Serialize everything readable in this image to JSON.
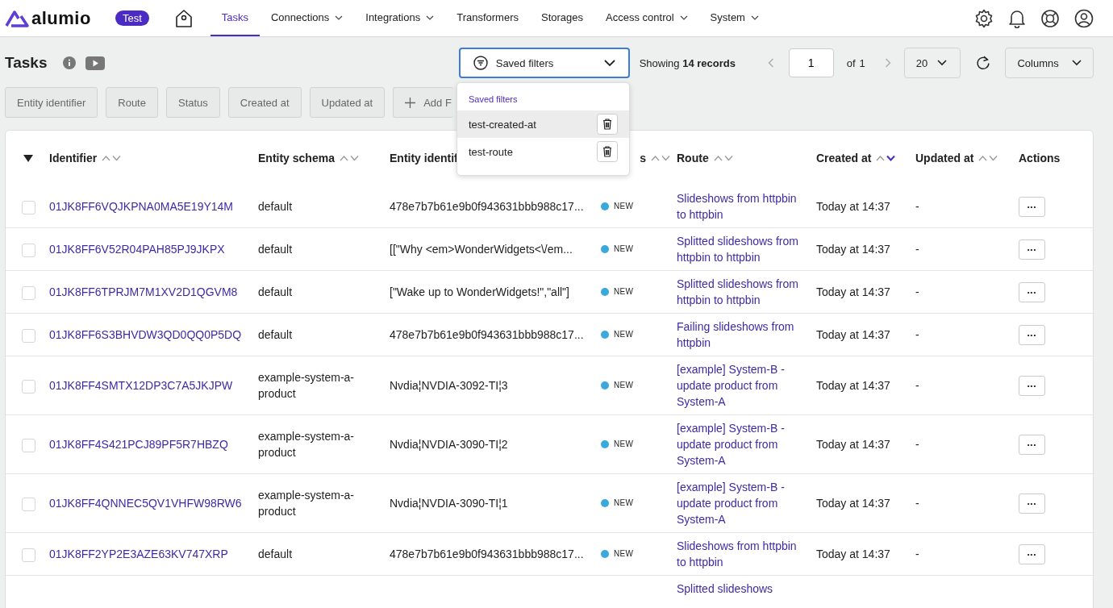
{
  "nav": {
    "logo": "alumio",
    "env_badge": "Test",
    "items": [
      {
        "label": "Tasks",
        "selected": true,
        "dropdown": false
      },
      {
        "label": "Connections",
        "selected": false,
        "dropdown": true
      },
      {
        "label": "Integrations",
        "selected": false,
        "dropdown": true
      },
      {
        "label": "Transformers",
        "selected": false,
        "dropdown": false
      },
      {
        "label": "Storages",
        "selected": false,
        "dropdown": false
      },
      {
        "label": "Access control",
        "selected": false,
        "dropdown": true
      },
      {
        "label": "System",
        "selected": false,
        "dropdown": true
      }
    ]
  },
  "page": {
    "title": "Tasks"
  },
  "toolbar": {
    "saved_filters": "Saved filters",
    "showing_label": "Showing",
    "showing_count": "14 records",
    "page": "1",
    "of_label": "of",
    "page_total": "1",
    "per_page": "20",
    "columns_button": "Columns"
  },
  "filters": [
    "Entity identifier",
    "Route",
    "Status",
    "Created at",
    "Updated at"
  ],
  "add_filter": "Add F",
  "saved_filters_menu": {
    "heading": "Saved filters",
    "items": [
      {
        "label": "test-created-at",
        "selected": true
      },
      {
        "label": "test-route",
        "selected": false
      }
    ]
  },
  "table": {
    "columns": [
      {
        "label": "Identifier",
        "kind": "text",
        "sortable": true,
        "sorted_desc": false
      },
      {
        "label": "Entity schema",
        "kind": "text",
        "sortable": true,
        "sorted_desc": false
      },
      {
        "label": "Entity identif",
        "kind": "text"
      },
      {
        "label": "s",
        "kind": "status",
        "sortable": true,
        "sorted_desc": false
      },
      {
        "label": "Route",
        "kind": "text",
        "sortable": true,
        "sorted_desc": false
      },
      {
        "label": "Created at",
        "kind": "text",
        "sortable": true,
        "sorted_desc": true
      },
      {
        "label": "Updated at",
        "kind": "text",
        "sortable": true,
        "sorted_desc": false
      },
      {
        "label": "Actions",
        "kind": "text"
      }
    ],
    "rows": [
      {
        "checked": false,
        "identifier": "01JK8FF6VQJKPNA0MA5E19Y14M",
        "schema": "default",
        "entity": "478e7b7b61e9b0f943631bbb988c17...",
        "status": "NEW",
        "color": "#3aa8dc",
        "route": "Slideshows from httpbin to httpbin",
        "created": "Today at 14:37",
        "updated": "-",
        "action": "•••"
      },
      {
        "checked": false,
        "identifier": "01JK8FF6V52R04PAH85PJ9JKPX",
        "schema": "default",
        "entity": "[[\"Why <em>WonderWidgets<\\/em...",
        "status": "NEW",
        "color": "#3aa8dc",
        "route": "Splitted slideshows from httpbin to httpbin",
        "created": "Today at 14:37",
        "updated": "-",
        "action": "•••"
      },
      {
        "checked": false,
        "identifier": "01JK8FF6TPRJM7M1XV2D1QGVM8",
        "schema": "default",
        "entity": "[\"Wake up to WonderWidgets!\",\"all\"]",
        "status": "NEW",
        "color": "#3aa8dc",
        "route": "Splitted slideshows from httpbin to httpbin",
        "created": "Today at 14:37",
        "updated": "-",
        "action": "•••"
      },
      {
        "checked": false,
        "identifier": "01JK8FF6S3BHVDW3QD0QQ0P5DQ",
        "schema": "default",
        "entity": "478e7b7b61e9b0f943631bbb988c17...",
        "status": "NEW",
        "color": "#3aa8dc",
        "route": "Failing slideshows from httpbin",
        "created": "Today at 14:37",
        "updated": "-",
        "action": "•••"
      },
      {
        "checked": false,
        "identifier": "01JK8FF4SMTX12DP3C7A5JKJPW",
        "schema": "example-system-a-product",
        "entity": "Nvdia¦NVDIA-3092-TI¦3",
        "status": "NEW",
        "color": "#3aa8dc",
        "route": "[example] System-B - update product from System-A",
        "created": "Today at 14:37",
        "updated": "-",
        "action": "•••"
      },
      {
        "checked": false,
        "identifier": "01JK8FF4S421PCJ89PF5R7HBZQ",
        "schema": "example-system-a-product",
        "entity": "Nvdia¦NVDIA-3090-TI¦2",
        "status": "NEW",
        "color": "#3aa8dc",
        "route": "[example] System-B - update product from System-A",
        "created": "Today at 14:37",
        "updated": "-",
        "action": "•••"
      },
      {
        "checked": false,
        "identifier": "01JK8FF4QNNEC5QV1VHFW98RW6",
        "schema": "example-system-a-product",
        "entity": "Nvdia¦NVDIA-3090-TI¦1",
        "status": "NEW",
        "color": "#3aa8dc",
        "route": "[example] System-B - update product from System-A",
        "created": "Today at 14:37",
        "updated": "-",
        "action": "•••"
      },
      {
        "checked": false,
        "identifier": "01JK8FF2YP2E3AZE63KV747XRP",
        "schema": "default",
        "entity": "478e7b7b61e9b0f943631bbb988c17...",
        "status": "NEW",
        "color": "#3aa8dc",
        "route": "Slideshows from httpbin to httpbin",
        "created": "Today at 14:37",
        "updated": "-",
        "action": "•••"
      }
    ],
    "partial_row_route": "Splitted slideshows"
  }
}
